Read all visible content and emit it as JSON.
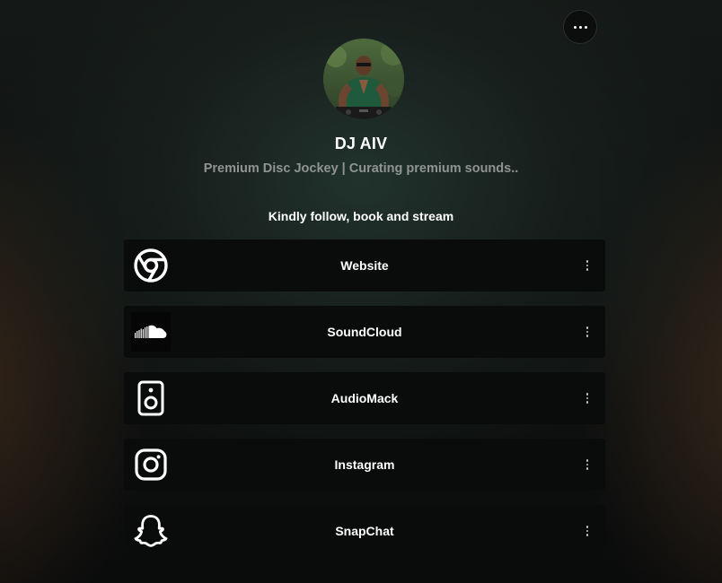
{
  "header": {
    "more_icon": "more-horizontal-icon"
  },
  "profile": {
    "name": "DJ AIV",
    "bio": "Premium Disc Jockey | Curating premium sounds..",
    "avatar_alt": "DJ AIV avatar"
  },
  "section": {
    "heading": "Kindly follow, book and stream"
  },
  "links": [
    {
      "label": "Website",
      "icon": "chrome-icon"
    },
    {
      "label": "SoundCloud",
      "icon": "soundcloud-icon"
    },
    {
      "label": "AudioMack",
      "icon": "speaker-icon"
    },
    {
      "label": "Instagram",
      "icon": "instagram-icon"
    },
    {
      "label": "SnapChat",
      "icon": "snapchat-icon"
    }
  ],
  "colors": {
    "card_background": "#0a0b0b",
    "bio_text": "#8f9492",
    "accent_green": "#1f5a3c"
  }
}
